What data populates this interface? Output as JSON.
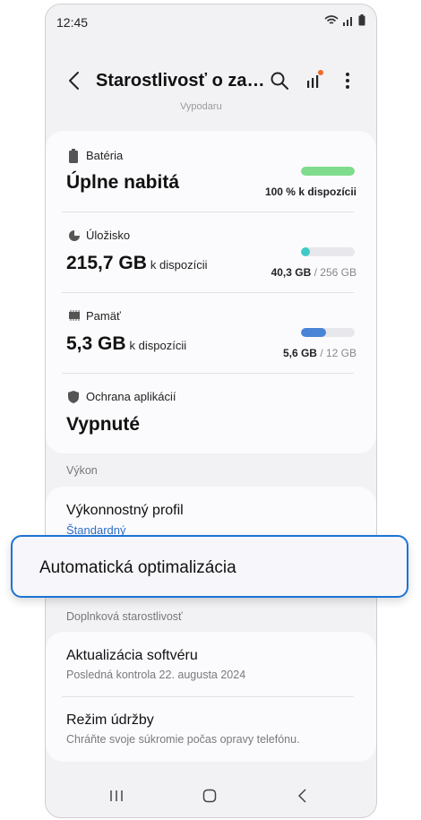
{
  "status": {
    "time": "12:45"
  },
  "appbar": {
    "title": "Starostlivosť o za…"
  },
  "faded_text": "Vypodaru",
  "battery": {
    "label": "Batéria",
    "value": "Úplne nabitá",
    "detail": "100 % k dispozícii",
    "fill": 1.0,
    "color": "#7fdc8c"
  },
  "storage": {
    "label": "Úložisko",
    "value": "215,7 GB",
    "unit": "k dispozícii",
    "used": "40,3 GB",
    "total": "/ 256 GB",
    "fill": 0.16,
    "color": "#3fc9c9"
  },
  "memory": {
    "label": "Pamäť",
    "value": "5,3 GB",
    "unit": "k dispozícii",
    "used": "5,6 GB",
    "total": "/ 12 GB",
    "fill": 0.47,
    "color": "#4a84d6"
  },
  "app_protection": {
    "label": "Ochrana aplikácií",
    "value": "Vypnuté"
  },
  "performance": {
    "section": "Výkon",
    "profile_title": "Výkonnostný profil",
    "profile_value": "Štandardný"
  },
  "auto_opt": {
    "label": "Automatická optimalizácia"
  },
  "extra": {
    "section": "Doplnková starostlivosť",
    "update_title": "Aktualizácia softvéru",
    "update_sub": "Posledná kontrola 22. augusta 2024",
    "maintenance_title": "Režim údržby",
    "maintenance_sub": "Chráňte svoje súkromie počas opravy telefónu."
  }
}
